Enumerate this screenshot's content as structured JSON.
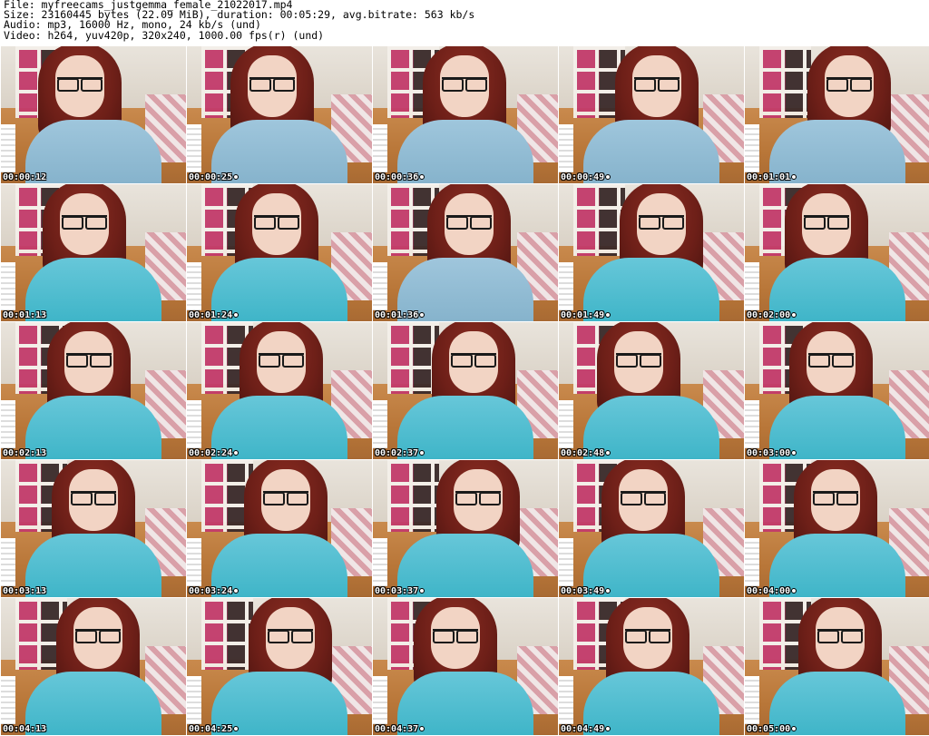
{
  "header": {
    "line1": "File: myfreecams_justgemma_female_21022017.mp4",
    "line2": "Size: 23160445 bytes (22.09 MiB), duration: 00:05:29, avg.bitrate: 563 kb/s",
    "line3": "Audio: mp3, 16000 Hz, mono, 24 kb/s (und)",
    "line4": "Video: h264, yuv420p, 320x240, 1000.00 fps(r) (und)"
  },
  "thumbnails": [
    {
      "timestamp": "00:00:12",
      "scene": "bedroom-grey-shirt"
    },
    {
      "timestamp": "00:00:25",
      "scene": "bedroom-grey-shirt"
    },
    {
      "timestamp": "00:00:36",
      "scene": "bedroom-grey-shirt"
    },
    {
      "timestamp": "00:00:49",
      "scene": "bedroom-grey-shirt"
    },
    {
      "timestamp": "00:01:01",
      "scene": "bedroom-grey-shirt"
    },
    {
      "timestamp": "00:01:13",
      "scene": "bedroom-teal-shirt"
    },
    {
      "timestamp": "00:01:24",
      "scene": "bedroom-teal-shirt"
    },
    {
      "timestamp": "00:01:36",
      "scene": "bedroom-grey-shirt"
    },
    {
      "timestamp": "00:01:49",
      "scene": "bedroom-teal-shirt"
    },
    {
      "timestamp": "00:02:00",
      "scene": "bedroom-teal-shirt"
    },
    {
      "timestamp": "00:02:13",
      "scene": "bedroom-teal-shirt"
    },
    {
      "timestamp": "00:02:24",
      "scene": "bedroom-teal-shirt"
    },
    {
      "timestamp": "00:02:37",
      "scene": "bedroom-teal-shirt"
    },
    {
      "timestamp": "00:02:48",
      "scene": "bedroom-teal-shirt"
    },
    {
      "timestamp": "00:03:00",
      "scene": "bedroom-teal-shirt"
    },
    {
      "timestamp": "00:03:13",
      "scene": "bedroom-teal-shirt"
    },
    {
      "timestamp": "00:03:24",
      "scene": "bedroom-teal-shirt"
    },
    {
      "timestamp": "00:03:37",
      "scene": "bedroom-teal-shirt"
    },
    {
      "timestamp": "00:03:49",
      "scene": "bedroom-teal-shirt"
    },
    {
      "timestamp": "00:04:00",
      "scene": "bedroom-teal-shirt"
    },
    {
      "timestamp": "00:04:13",
      "scene": "bedroom-teal-shirt"
    },
    {
      "timestamp": "00:04:25",
      "scene": "bedroom-teal-shirt"
    },
    {
      "timestamp": "00:04:37",
      "scene": "bedroom-teal-shirt"
    },
    {
      "timestamp": "00:04:49",
      "scene": "bedroom-teal-shirt"
    },
    {
      "timestamp": "00:05:00",
      "scene": "bedroom-teal-shirt"
    }
  ],
  "colors": {
    "background": "#ffffff",
    "header_text": "#000000",
    "timestamp_text": "#ffffff",
    "timestamp_outline": "#000000"
  }
}
